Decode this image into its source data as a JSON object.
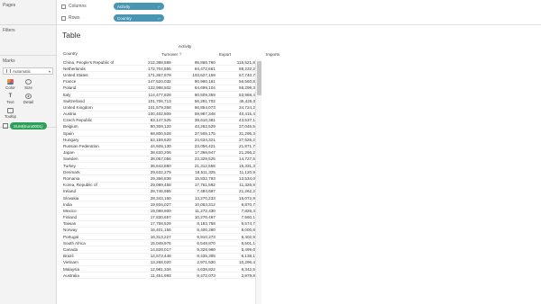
{
  "left_panel": {
    "pages_title": "Pages",
    "filters_title": "Filters",
    "marks_title": "Marks",
    "marks_type": "Automatic",
    "marks_buttons": [
      {
        "label": "Color",
        "icon": "color-icon"
      },
      {
        "label": "Size",
        "icon": "size-icon"
      },
      {
        "label": "Text",
        "icon": "text-icon"
      },
      {
        "label": "Detail",
        "icon": "detail-icon"
      },
      {
        "label": "Tooltip",
        "icon": "tooltip-icon"
      }
    ],
    "measure_pill": "SUM(Euro0001)"
  },
  "shelves": {
    "columns_label": "Columns",
    "columns_pill": "Activity",
    "rows_label": "Rows",
    "rows_pill": "Country"
  },
  "view": {
    "title": "Table",
    "activity_header": "Activity",
    "headers": [
      "Country",
      "Turnover",
      "Export",
      "Imports"
    ],
    "rows": [
      [
        "China, People's Republic of",
        "212,388,589",
        "95,866,760",
        "116,521,829"
      ],
      [
        "Netherlands",
        "172,704,555",
        "84,472,661",
        "88,232,274"
      ],
      [
        "United States",
        "171,367,879",
        "103,627,159",
        "67,740,720"
      ],
      [
        "France",
        "147,520,032",
        "90,960,181",
        "56,560,851"
      ],
      [
        "Poland",
        "122,998,502",
        "64,699,104",
        "58,299,398"
      ],
      [
        "Italy",
        "114,477,828",
        "60,509,359",
        "53,968,469"
      ],
      [
        "Switzerland",
        "101,706,713",
        "56,281,702",
        "45,425,011"
      ],
      [
        "United Kingdom",
        "101,579,358",
        "66,854,073",
        "34,724,285"
      ],
      [
        "Austria",
        "100,402,809",
        "59,987,348",
        "40,415,461"
      ],
      [
        "Czech Republic",
        "83,147,525",
        "39,610,381",
        "43,537,144"
      ],
      [
        "Belgium",
        "80,309,120",
        "43,262,529",
        "37,046,580"
      ],
      [
        "Spain",
        "68,800,528",
        "37,505,175",
        "31,295,353"
      ],
      [
        "Hungary",
        "52,159,620",
        "24,634,321",
        "27,525,299"
      ],
      [
        "Russian Federation",
        "44,928,130",
        "23,056,421",
        "21,871,709"
      ],
      [
        "Japan",
        "38,633,206",
        "17,366,947",
        "21,266,259"
      ],
      [
        "Sweden",
        "38,057,056",
        "23,329,525",
        "14,727,531"
      ],
      [
        "Turkey",
        "36,643,880",
        "21,312,558",
        "15,331,322"
      ],
      [
        "Denmark",
        "29,632,279",
        "18,511,325",
        "11,120,954"
      ],
      [
        "Romania",
        "29,366,839",
        "15,832,793",
        "13,534,046"
      ],
      [
        "Korea, Republic of",
        "29,089,458",
        "17,761,592",
        "11,326,866"
      ],
      [
        "Ireland",
        "28,746,955",
        "7,484,697",
        "21,262,258"
      ],
      [
        "Slovakia",
        "28,343,160",
        "13,270,233",
        "15,072,927"
      ],
      [
        "India",
        "19,934,027",
        "10,063,312",
        "9,870,715"
      ],
      [
        "Mexico",
        "19,098,900",
        "11,272,430",
        "7,826,470"
      ],
      [
        "Finland",
        "17,830,657",
        "10,270,467",
        "7,560,190"
      ],
      [
        "Taiwan",
        "17,758,529",
        "8,183,758",
        "9,574,771"
      ],
      [
        "Norway",
        "16,401,155",
        "8,400,260",
        "8,000,895"
      ],
      [
        "Portugal",
        "16,313,227",
        "9,910,273",
        "6,402,954"
      ],
      [
        "South Africa",
        "15,049,976",
        "6,548,870",
        "8,501,106"
      ],
      [
        "Canada",
        "14,828,017",
        "9,328,960",
        "5,499,057"
      ],
      [
        "Brazil",
        "14,573,448",
        "8,435,305",
        "6,138,143"
      ],
      [
        "Vietnam",
        "13,268,020",
        "2,971,530",
        "10,296,490"
      ],
      [
        "Malaysia",
        "12,981,334",
        "4,638,822",
        "8,342,512"
      ],
      [
        "Australia",
        "11,451,993",
        "8,472,073",
        "2,979,920"
      ]
    ]
  }
}
